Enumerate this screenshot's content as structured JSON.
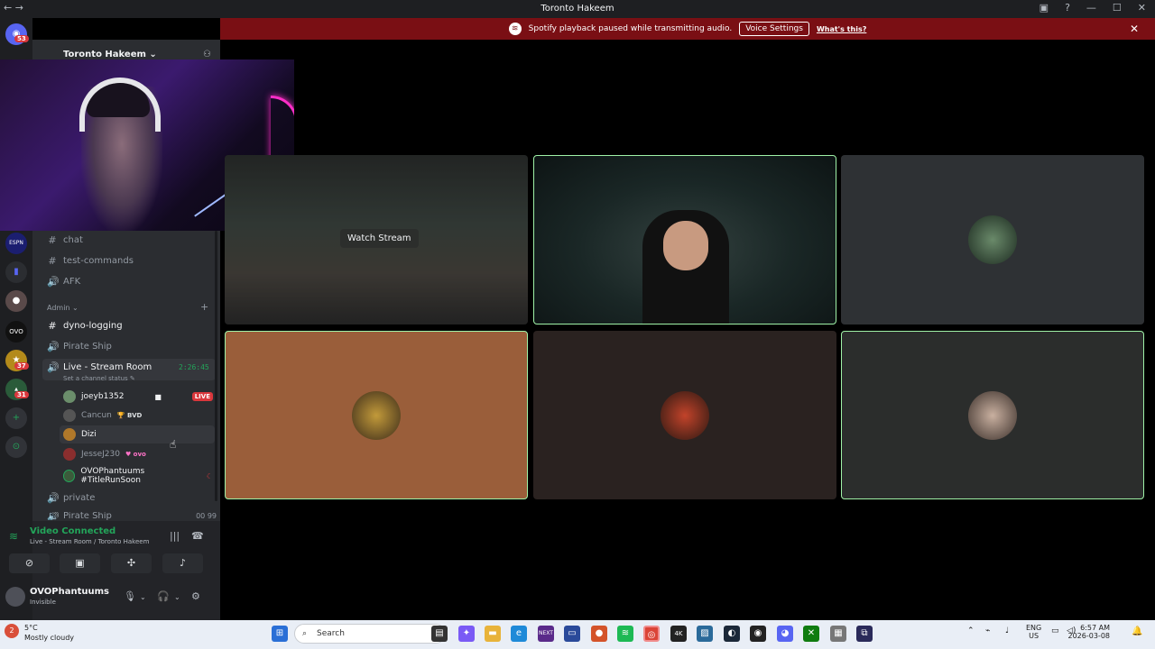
{
  "window": {
    "title": "Toronto Hakeem",
    "minimize": "—",
    "maximize": "☐",
    "close": "✕"
  },
  "banner": {
    "text": "Spotify playback paused while transmitting audio.",
    "button": "Voice Settings",
    "link": "What's this?"
  },
  "guilds": {
    "badge_top": "53",
    "badge_a": "37",
    "badge_b": "31"
  },
  "server": {
    "name": "Toronto Hakeem ⌄"
  },
  "channels": [
    {
      "name": "chat",
      "sym": "#"
    },
    {
      "name": "test-commands",
      "sym": "#"
    },
    {
      "name": "AFK",
      "sym": "🔊"
    }
  ],
  "admin_category": "Admin ⌄",
  "admin_channels": [
    {
      "name": "dyno-logging",
      "sym": "#"
    },
    {
      "name": "Pirate Ship",
      "sym": "🔊"
    }
  ],
  "room": {
    "name": "Live - Stream Room",
    "time": "2:26:45",
    "status": "Set a channel status ✎",
    "users": [
      {
        "name": "joeyb1352",
        "badge": "LIVE"
      },
      {
        "name": "Cancun",
        "badge": "🏆 BVD"
      },
      {
        "name": "Dizi",
        "badge": ""
      },
      {
        "name": "JesseJ230",
        "badge": "♥ ovo"
      },
      {
        "name": "OVOPhantuums #TitleRunSoon",
        "badge": ""
      }
    ]
  },
  "after_channels": [
    {
      "name": "private",
      "sym": "🔊"
    },
    {
      "name": "Pirate Ship",
      "sym": "🔊",
      "counts": "00  99"
    }
  ],
  "voice": {
    "title": "Video Connected",
    "sub": "Live - Stream Room / Toronto Hakeem"
  },
  "me": {
    "name": "OVOPhantuums",
    "status": "Invisible"
  },
  "stream": {
    "watch_label": "Watch Stream"
  },
  "taskbar": {
    "temp": "5°C",
    "desc": "Mostly cloudy",
    "search": "Search",
    "lang1": "ENG",
    "lang2": "US",
    "time": "6:57 AM",
    "date": "2026-03-08",
    "weather_badge": "2"
  }
}
